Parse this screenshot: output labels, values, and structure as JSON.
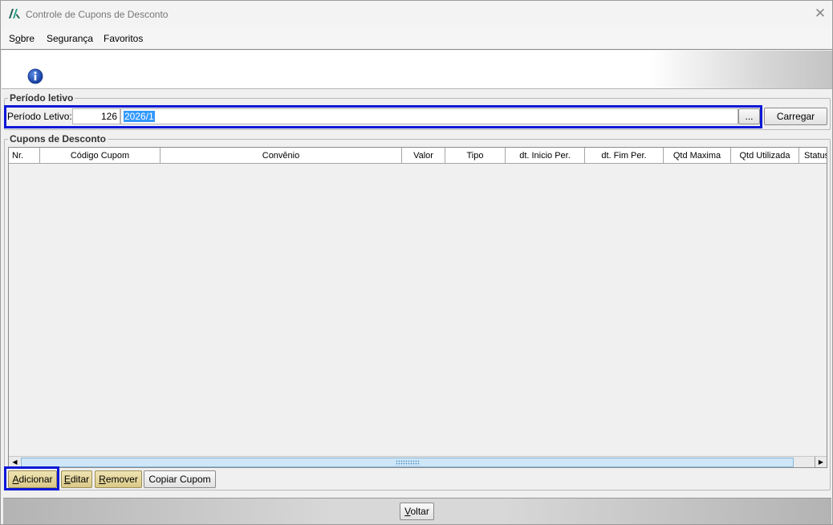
{
  "window": {
    "title": "Controle de Cupons de Desconto",
    "close_glyph": "✕"
  },
  "menu": [
    {
      "pre": "S",
      "ul": "o",
      "post": "bre"
    },
    {
      "pre": "",
      "ul": "",
      "post": "Segurança"
    },
    {
      "pre": "",
      "ul": "",
      "post": "Favoritos"
    }
  ],
  "periodo": {
    "group_title": "Período letivo",
    "label": "Período Letivo:",
    "code": "126",
    "description": "2026/1",
    "lookup_label": "...",
    "load_button": "Carregar"
  },
  "cupons": {
    "group_title": "Cupons de Desconto",
    "columns": [
      "Nr.",
      "Código Cupom",
      "Convênio",
      "Valor",
      "Tipo",
      "dt. Inicio Per.",
      "dt. Fim Per.",
      "Qtd Maxima",
      "Qtd Utilizada",
      "Status"
    ],
    "rows": []
  },
  "actions": {
    "add": {
      "pre": "",
      "ul": "A",
      "post": "dicionar"
    },
    "edit": {
      "pre": "",
      "ul": "E",
      "post": "ditar"
    },
    "remove": {
      "pre": "",
      "ul": "R",
      "post": "emover"
    },
    "copy": {
      "pre": "",
      "ul": "",
      "post": "Copiar Cupom"
    }
  },
  "footer": {
    "back": {
      "pre": "",
      "ul": "V",
      "post": "oltar"
    }
  },
  "colors": {
    "highlight": "#0b18d6",
    "selection": "#3399ff",
    "accent_button": "#d9c887"
  },
  "icons": [
    "app-logo-icon",
    "close-icon",
    "info-icon",
    "scroll-left-icon",
    "scroll-right-icon"
  ]
}
